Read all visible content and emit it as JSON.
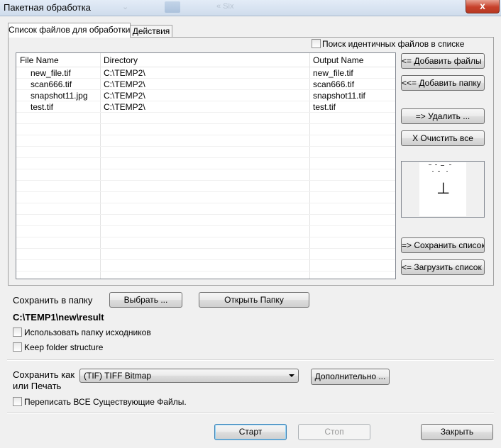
{
  "window": {
    "title": "Пакетная обработка",
    "close_label": "x",
    "ghost_text": "« Six"
  },
  "tabs": [
    {
      "label": "Список файлов для обработки",
      "active": true
    },
    {
      "label": "Действия",
      "active": false
    }
  ],
  "file_list": {
    "identical_search_label": "Поиск идентичных файлов в списке",
    "identical_search_checked": false,
    "columns": [
      "File Name",
      "Directory",
      "Output Name"
    ],
    "rows": [
      {
        "name": "new_file.tif",
        "dir": "C:\\TEMP2\\",
        "out": "new_file.tif"
      },
      {
        "name": "scan666.tif",
        "dir": "C:\\TEMP2\\",
        "out": "scan666.tif"
      },
      {
        "name": "snapshot11.jpg",
        "dir": "C:\\TEMP2\\",
        "out": "snapshot11.tif"
      },
      {
        "name": "test.tif",
        "dir": "C:\\TEMP2\\",
        "out": "test.tif"
      }
    ]
  },
  "side_buttons": {
    "add_files": "<= Добавить файлы ...",
    "add_folder": "<<= Добавить папку ...",
    "remove": "=> Удалить ...",
    "clear_all": "X Очистить все",
    "save_list": "=> Сохранить список ...",
    "load_list": "<= Загрузить список ..."
  },
  "preview": {
    "glyph": "⊥"
  },
  "output": {
    "save_to_label": "Сохранить в папку",
    "choose_button": "Выбрать ...",
    "open_folder_button": "Открыть Папку",
    "path": "C:\\TEMP1\\new\\result",
    "use_source_folder_label": "Использовать папку исходников",
    "use_source_folder_checked": false,
    "keep_structure_label": "Keep folder structure",
    "keep_structure_checked": false
  },
  "format": {
    "save_as_label_line1": "Сохранить как",
    "save_as_label_line2": "или Печать",
    "selected": "(TIF) TIFF Bitmap",
    "advanced_button": "Дополнительно ...",
    "overwrite_label": "Переписать ВСЕ Существующие Файлы.",
    "overwrite_checked": false
  },
  "footer": {
    "start": "Старт",
    "stop": "Стоп",
    "close": "Закрыть"
  }
}
